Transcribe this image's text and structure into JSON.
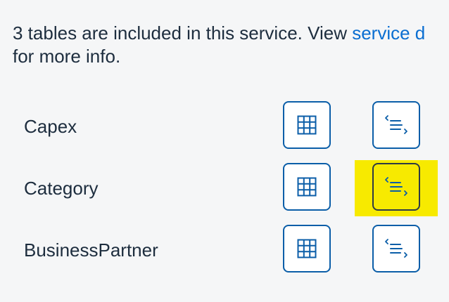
{
  "intro": {
    "text_before": "3 tables are included in this service. View ",
    "link_text": "service d",
    "text_after": "for more info."
  },
  "tables": [
    {
      "name": "Capex",
      "table_icon": "table-grid-icon",
      "code_icon": "code-list-icon",
      "highlighted": false
    },
    {
      "name": "Category",
      "table_icon": "table-grid-icon",
      "code_icon": "code-list-icon",
      "highlighted": true
    },
    {
      "name": "BusinessPartner",
      "table_icon": "table-grid-icon",
      "code_icon": "code-list-icon",
      "highlighted": false
    }
  ],
  "colors": {
    "accent": "#0b5ea8",
    "link": "#0a6ed1",
    "highlight": "#f7ea00",
    "background": "#f5f6f7"
  }
}
